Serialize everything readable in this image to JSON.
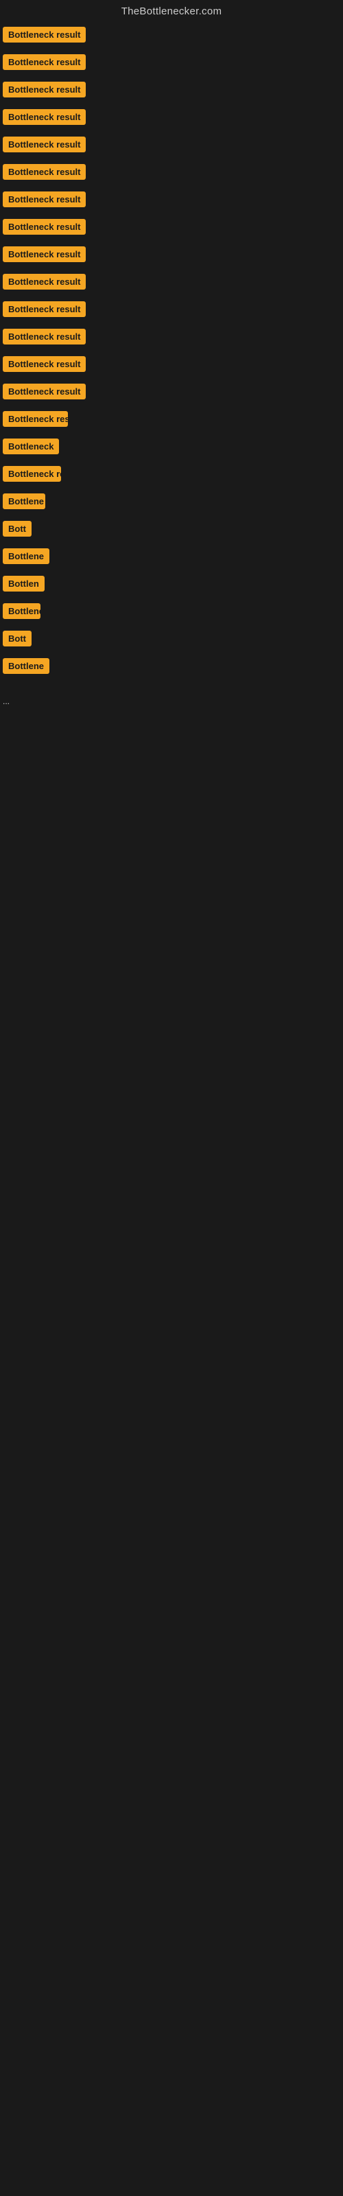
{
  "header": {
    "title": "TheBottlenecker.com"
  },
  "items": [
    {
      "id": 1,
      "label": "Bottleneck result",
      "widthClass": "w-1"
    },
    {
      "id": 2,
      "label": "Bottleneck result",
      "widthClass": "w-2"
    },
    {
      "id": 3,
      "label": "Bottleneck result",
      "widthClass": "w-3"
    },
    {
      "id": 4,
      "label": "Bottleneck result",
      "widthClass": "w-4"
    },
    {
      "id": 5,
      "label": "Bottleneck result",
      "widthClass": "w-5"
    },
    {
      "id": 6,
      "label": "Bottleneck result",
      "widthClass": "w-6"
    },
    {
      "id": 7,
      "label": "Bottleneck result",
      "widthClass": "w-7"
    },
    {
      "id": 8,
      "label": "Bottleneck result",
      "widthClass": "w-8"
    },
    {
      "id": 9,
      "label": "Bottleneck result",
      "widthClass": "w-9"
    },
    {
      "id": 10,
      "label": "Bottleneck result",
      "widthClass": "w-10"
    },
    {
      "id": 11,
      "label": "Bottleneck result",
      "widthClass": "w-11"
    },
    {
      "id": 12,
      "label": "Bottleneck result",
      "widthClass": "w-12"
    },
    {
      "id": 13,
      "label": "Bottleneck result",
      "widthClass": "w-13"
    },
    {
      "id": 14,
      "label": "Bottleneck result",
      "widthClass": "w-14"
    },
    {
      "id": 15,
      "label": "Bottleneck res",
      "widthClass": "w-15"
    },
    {
      "id": 16,
      "label": "Bottleneck",
      "widthClass": "w-16"
    },
    {
      "id": 17,
      "label": "Bottleneck re",
      "widthClass": "w-17"
    },
    {
      "id": 18,
      "label": "Bottlene",
      "widthClass": "w-18"
    },
    {
      "id": 19,
      "label": "Bott",
      "widthClass": "w-19"
    },
    {
      "id": 20,
      "label": "Bottlene",
      "widthClass": "w-20"
    },
    {
      "id": 21,
      "label": "Bottlen",
      "widthClass": "w-21"
    },
    {
      "id": 22,
      "label": "Bottleneck",
      "widthClass": "w-22"
    },
    {
      "id": 23,
      "label": "Bott",
      "widthClass": "w-22"
    },
    {
      "id": 24,
      "label": "Bottlene",
      "widthClass": "w-23"
    }
  ],
  "ellipsis": "..."
}
